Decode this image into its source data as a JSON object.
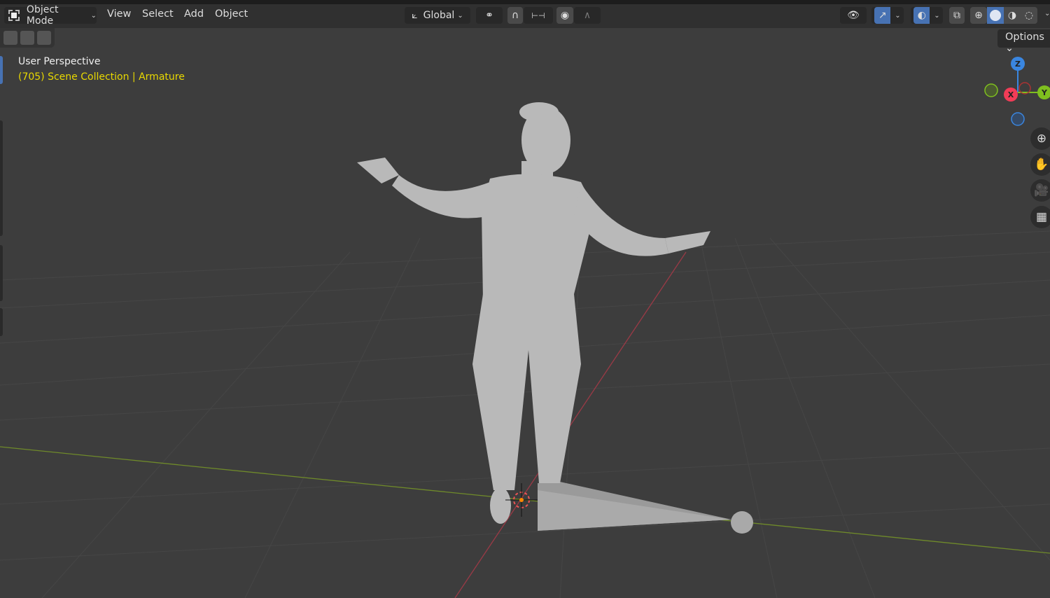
{
  "header": {
    "mode_label": "Object Mode",
    "menus": [
      "View",
      "Select",
      "Add",
      "Object"
    ],
    "transform_orientation": "Global",
    "options_label": "Options"
  },
  "viewport": {
    "view_name": "User Perspective",
    "collection_info": "(705) Scene Collection | Armature",
    "text_color": "#e8d800"
  },
  "gizmo": {
    "z": "Z",
    "x": "X",
    "y": "Y"
  },
  "colors": {
    "x_axis": "#f23c57",
    "y_axis": "#7fbf1f",
    "z_axis": "#3a86e0",
    "accent": "#4772b3"
  }
}
